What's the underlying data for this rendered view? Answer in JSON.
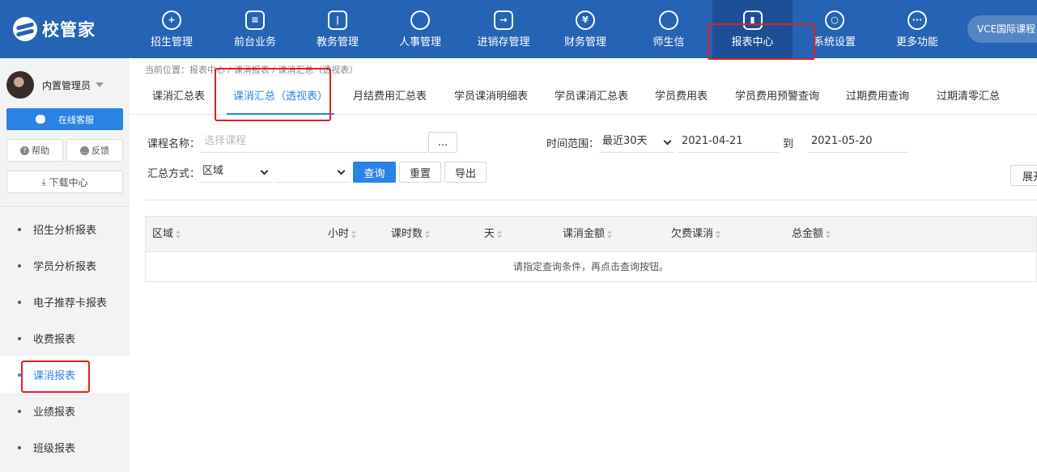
{
  "brand": {
    "name": "校管家"
  },
  "nav": {
    "items": [
      {
        "label": "招生管理",
        "icon": "user-plus-icon"
      },
      {
        "label": "前台业务",
        "icon": "monitor-icon"
      },
      {
        "label": "教务管理",
        "icon": "book-icon"
      },
      {
        "label": "人事管理",
        "icon": "person-icon"
      },
      {
        "label": "进销存管理",
        "icon": "arrow-in-box-icon"
      },
      {
        "label": "财务管理",
        "icon": "yen-bag-icon"
      },
      {
        "label": "师生信",
        "icon": "chat-bubble-icon"
      },
      {
        "label": "报表中心",
        "icon": "bar-chart-icon",
        "active": true
      },
      {
        "label": "系统设置",
        "icon": "gear-icon"
      },
      {
        "label": "更多功能",
        "icon": "more-icon"
      }
    ],
    "school_button": "VCE国际课程"
  },
  "sidebar": {
    "user_name": "内置管理员",
    "online_service": "在线客服",
    "help": "帮助",
    "feedback": "反馈",
    "download_center": "下载中心",
    "items": [
      {
        "label": "招生分析报表"
      },
      {
        "label": "学员分析报表"
      },
      {
        "label": "电子推荐卡报表"
      },
      {
        "label": "收费报表"
      },
      {
        "label": "课消报表",
        "active": true
      },
      {
        "label": "业绩报表"
      },
      {
        "label": "班级报表"
      }
    ]
  },
  "breadcrumb": "当前位置：报表中心 / 课消报表 / 课消汇总（透视表）",
  "tabs": [
    {
      "label": "课消汇总表"
    },
    {
      "label": "课消汇总（透视表）",
      "active": true
    },
    {
      "label": "月结费用汇总表"
    },
    {
      "label": "学员课消明细表"
    },
    {
      "label": "学员课消汇总表"
    },
    {
      "label": "学员费用表"
    },
    {
      "label": "学员费用预警查询"
    },
    {
      "label": "过期费用查询"
    },
    {
      "label": "过期清零汇总"
    }
  ],
  "filters": {
    "course_label": "课程名称：",
    "course_placeholder": "选择课程",
    "browse_button": "...",
    "time_label": "时间范围：",
    "time_range_value": "最近30天",
    "date_from": "2021-04-21",
    "to_label": "到",
    "date_to": "2021-05-20",
    "group_label": "汇总方式：",
    "group_value": "区域",
    "group_value2": "",
    "query_button": "查询",
    "reset_button": "重置",
    "export_button": "导出",
    "expand_button": "展开"
  },
  "table": {
    "columns": [
      "区域",
      "小时",
      "课时数",
      "天",
      "课消金额",
      "欠费课消",
      "总金额"
    ],
    "empty_message": "请指定查询条件，再点击查询按钮。"
  },
  "colors": {
    "topbar": "#2563b4",
    "accent": "#2a82e4",
    "annotation": "#e02020"
  }
}
